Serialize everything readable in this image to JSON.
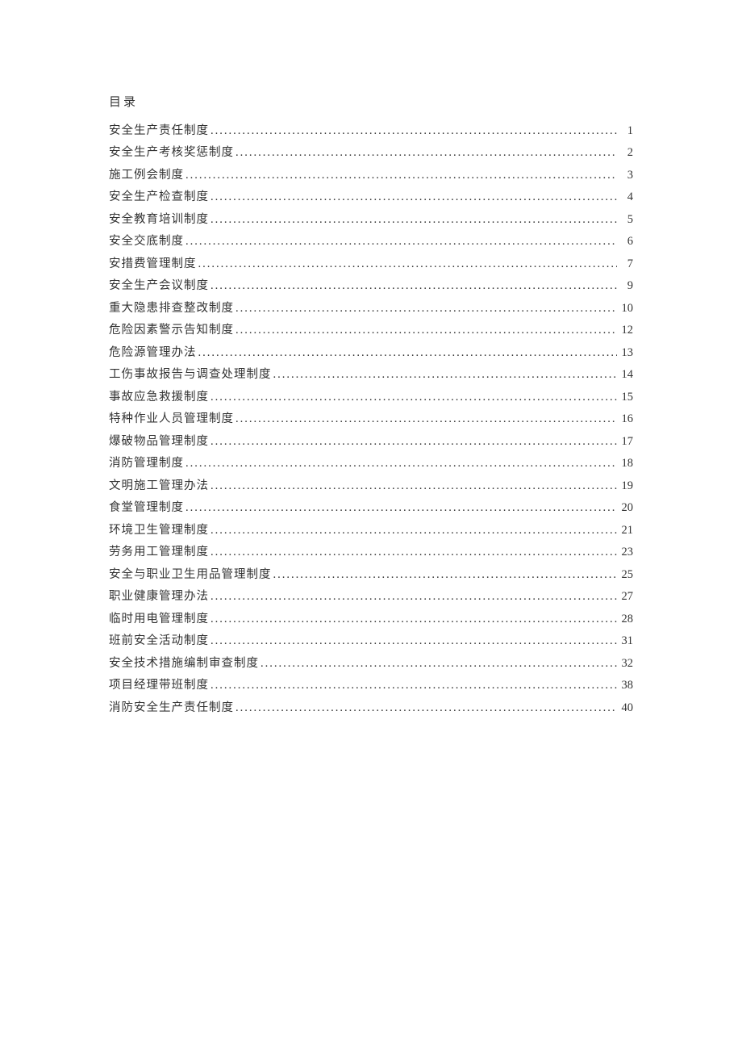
{
  "heading": "目录",
  "entries": [
    {
      "label": "安全生产责任制度",
      "page": "1"
    },
    {
      "label": "安全生产考核奖惩制度",
      "page": "2"
    },
    {
      "label": "施工例会制度",
      "page": "3"
    },
    {
      "label": "安全生产检查制度",
      "page": "4"
    },
    {
      "label": "安全教育培训制度",
      "page": "5"
    },
    {
      "label": "安全交底制度",
      "page": "6"
    },
    {
      "label": "安措费管理制度",
      "page": "7"
    },
    {
      "label": "安全生产会议制度",
      "page": "9"
    },
    {
      "label": "重大隐患排查整改制度",
      "page": "10"
    },
    {
      "label": "危险因素警示告知制度",
      "page": "12"
    },
    {
      "label": "危险源管理办法",
      "page": "13"
    },
    {
      "label": "工伤事故报告与调查处理制度",
      "page": "14"
    },
    {
      "label": "事故应急救援制度",
      "page": "15"
    },
    {
      "label": "特种作业人员管理制度",
      "page": "16"
    },
    {
      "label": "爆破物品管理制度",
      "page": "17"
    },
    {
      "label": "消防管理制度",
      "page": "18"
    },
    {
      "label": "文明施工管理办法",
      "page": "19"
    },
    {
      "label": "食堂管理制度",
      "page": "20"
    },
    {
      "label": "环境卫生管理制度",
      "page": "21"
    },
    {
      "label": "劳务用工管理制度",
      "page": "23"
    },
    {
      "label": "安全与职业卫生用品管理制度",
      "page": "25"
    },
    {
      "label": "职业健康管理办法",
      "page": "27"
    },
    {
      "label": "临时用电管理制度",
      "page": "28"
    },
    {
      "label": "班前安全活动制度",
      "page": "31"
    },
    {
      "label": "安全技术措施编制审查制度",
      "page": "32"
    },
    {
      "label": "项目经理带班制度",
      "page": "38"
    },
    {
      "label": "消防安全生产责任制度",
      "page": "40"
    }
  ]
}
